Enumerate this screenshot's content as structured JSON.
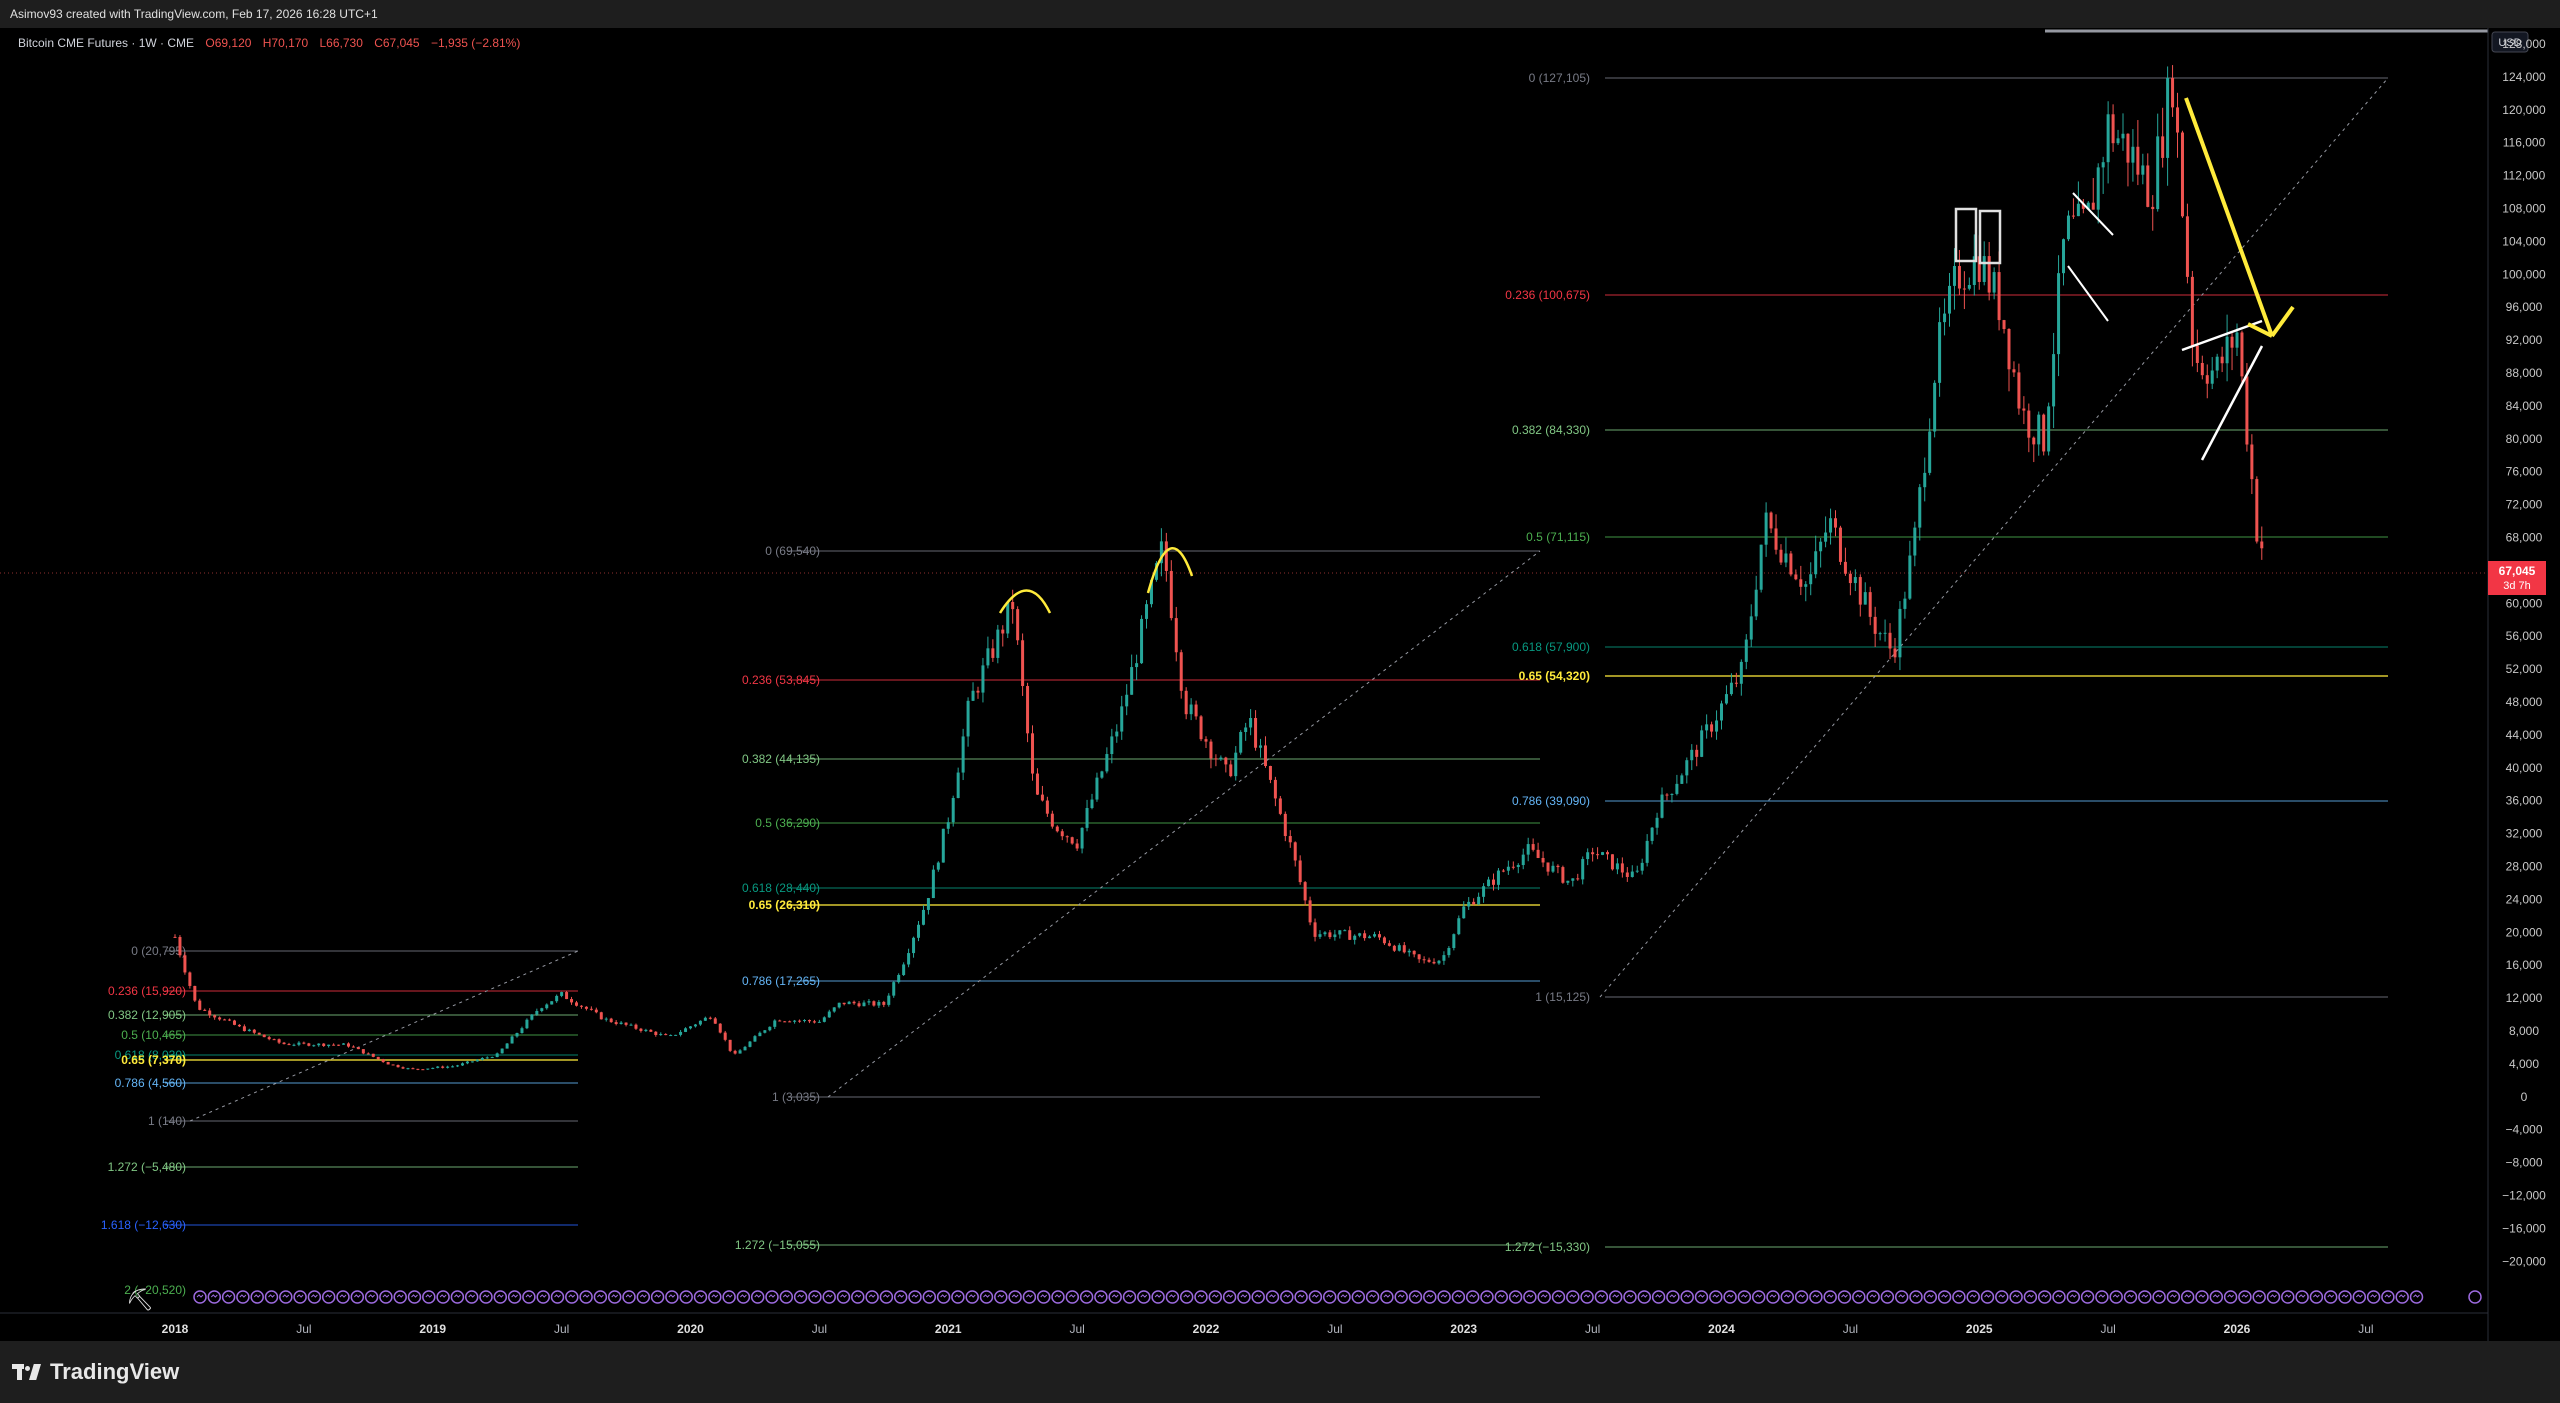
{
  "credit": "Asimov93 created with TradingView.com, Feb 17, 2026 16:28 UTC+1",
  "legend": {
    "symbol": "Bitcoin CME Futures · 1W · CME",
    "open": "O69,120",
    "high": "H70,170",
    "low": "L66,730",
    "close": "C67,045",
    "change": "−1,935 (−2.81%)"
  },
  "currency": "USD",
  "price_badge": {
    "price": "67,045",
    "countdown": "3d 7h"
  },
  "brand": "TradingView",
  "colors": {
    "up": "#26a69a",
    "down": "#ef5350",
    "background": "#000000",
    "fib_0": "#787b86",
    "fib_0236": "#f23645",
    "fib_0382": "#81c784",
    "fib_05": "#4caf50",
    "fib_0618": "#089981",
    "fib_065": "#ffeb3b",
    "fib_0786": "#64b5f6",
    "fib_1": "#787b86",
    "fib_1272": "#81c784",
    "fib_1618": "#2962ff",
    "annotation_yellow": "#ffeb3b"
  },
  "chart_data": {
    "type": "candlestick",
    "title": "",
    "y_axis_labels": [
      "128,000",
      "124,000",
      "120,000",
      "116,000",
      "112,000",
      "108,000",
      "104,000",
      "100,000",
      "96,000",
      "92,000",
      "88,000",
      "84,000",
      "80,000",
      "76,000",
      "72,000",
      "68,000",
      "64,000",
      "60,000",
      "56,000",
      "52,000",
      "48,000",
      "44,000",
      "40,000",
      "36,000",
      "32,000",
      "28,000",
      "24,000",
      "20,000",
      "16,000",
      "12,000",
      "8,000",
      "4,000",
      "0",
      "−4,000",
      "−8,000",
      "−12,000",
      "−16,000",
      "−20,000"
    ],
    "x_axis_labels": [
      {
        "label": "2018",
        "bold": true
      },
      {
        "label": "Jul",
        "bold": false
      },
      {
        "label": "2019",
        "bold": true
      },
      {
        "label": "Jul",
        "bold": false
      },
      {
        "label": "2020",
        "bold": true
      },
      {
        "label": "Jul",
        "bold": false
      },
      {
        "label": "2021",
        "bold": true
      },
      {
        "label": "Jul",
        "bold": false
      },
      {
        "label": "2022",
        "bold": true
      },
      {
        "label": "Jul",
        "bold": false
      },
      {
        "label": "2023",
        "bold": true
      },
      {
        "label": "Jul",
        "bold": false
      },
      {
        "label": "2024",
        "bold": true
      },
      {
        "label": "Jul",
        "bold": false
      },
      {
        "label": "2025",
        "bold": true
      },
      {
        "label": "Jul",
        "bold": false
      },
      {
        "label": "2026",
        "bold": true
      },
      {
        "label": "Jul",
        "bold": false
      }
    ],
    "price_path": [
      [
        "2018-01",
        19500
      ],
      [
        "2018-02",
        11000
      ],
      [
        "2018-04",
        8500
      ],
      [
        "2018-06",
        6500
      ],
      [
        "2018-09",
        6400
      ],
      [
        "2018-11",
        4000
      ],
      [
        "2018-12",
        3400
      ],
      [
        "2019-02",
        3800
      ],
      [
        "2019-04",
        5200
      ],
      [
        "2019-06",
        11000
      ],
      [
        "2019-07",
        12500
      ],
      [
        "2019-09",
        9500
      ],
      [
        "2019-12",
        7300
      ],
      [
        "2020-02",
        10000
      ],
      [
        "2020-03",
        5000
      ],
      [
        "2020-05",
        9500
      ],
      [
        "2020-07",
        9200
      ],
      [
        "2020-08",
        11500
      ],
      [
        "2020-10",
        11300
      ],
      [
        "2020-11",
        17000
      ],
      [
        "2020-12",
        24000
      ],
      [
        "2021-01",
        34000
      ],
      [
        "2021-02",
        48000
      ],
      [
        "2021-04",
        60000
      ],
      [
        "2021-05",
        37000
      ],
      [
        "2021-06",
        33000
      ],
      [
        "2021-07",
        31000
      ],
      [
        "2021-09",
        46000
      ],
      [
        "2021-11",
        67000
      ],
      [
        "2021-12",
        48000
      ],
      [
        "2022-02",
        39000
      ],
      [
        "2022-03",
        46000
      ],
      [
        "2022-05",
        30000
      ],
      [
        "2022-06",
        20000
      ],
      [
        "2022-09",
        19500
      ],
      [
        "2022-11",
        16500
      ],
      [
        "2022-12",
        16800
      ],
      [
        "2023-01",
        23000
      ],
      [
        "2023-03",
        28000
      ],
      [
        "2023-04",
        30000
      ],
      [
        "2023-06",
        26000
      ],
      [
        "2023-07",
        30000
      ],
      [
        "2023-09",
        26500
      ],
      [
        "2023-10",
        35000
      ],
      [
        "2023-12",
        43000
      ],
      [
        "2024-02",
        52000
      ],
      [
        "2024-03",
        70000
      ],
      [
        "2024-05",
        62000
      ],
      [
        "2024-06",
        70000
      ],
      [
        "2024-08",
        58000
      ],
      [
        "2024-09",
        54000
      ],
      [
        "2024-10",
        68000
      ],
      [
        "2024-11",
        90000
      ],
      [
        "2024-12",
        100000
      ],
      [
        "2025-01",
        102000
      ],
      [
        "2025-02",
        96000
      ],
      [
        "2025-03",
        83000
      ],
      [
        "2025-04",
        80000
      ],
      [
        "2025-05",
        105000
      ],
      [
        "2025-06",
        106000
      ],
      [
        "2025-07",
        118000
      ],
      [
        "2025-08",
        115000
      ],
      [
        "2025-09",
        110000
      ],
      [
        "2025-10",
        124000
      ],
      [
        "2025-11",
        90000
      ],
      [
        "2025-12",
        88000
      ],
      [
        "2026-01",
        93000
      ],
      [
        "2026-02",
        67045
      ]
    ],
    "fib_sets": [
      {
        "levels": [
          {
            "label": "0 (20,795)",
            "color": "fib_0"
          },
          {
            "label": "0.236 (15,920)",
            "color": "fib_0236"
          },
          {
            "label": "0.382 (12,905)",
            "color": "fib_0382"
          },
          {
            "label": "0.5 (10,465)",
            "color": "fib_05"
          },
          {
            "label": "0.618 (8,030)",
            "color": "fib_0618"
          },
          {
            "label": "0.65 (7,370)",
            "color": "fib_065"
          },
          {
            "label": "0.786 (4,560)",
            "color": "fib_0786"
          },
          {
            "label": "1 (140)",
            "color": "fib_1"
          },
          {
            "label": "1.272 (−5,480)",
            "color": "fib_1272"
          },
          {
            "label": "1.618 (−12,630)",
            "color": "fib_1618"
          },
          {
            "label": "2 (−20,520)",
            "color": "fib_05"
          }
        ]
      },
      {
        "levels": [
          {
            "label": "0 (69,540)",
            "color": "fib_0"
          },
          {
            "label": "0.236 (53,845)",
            "color": "fib_0236"
          },
          {
            "label": "0.382 (44,135)",
            "color": "fib_0382"
          },
          {
            "label": "0.5 (36,290)",
            "color": "fib_05"
          },
          {
            "label": "0.618 (28,440)",
            "color": "fib_0618"
          },
          {
            "label": "0.65 (26,310)",
            "color": "fib_065"
          },
          {
            "label": "0.786 (17,265)",
            "color": "fib_0786"
          },
          {
            "label": "1 (3,035)",
            "color": "fib_1"
          },
          {
            "label": "1.272 (−15,055)",
            "color": "fib_1272"
          }
        ]
      },
      {
        "levels": [
          {
            "label": "0 (127,105)",
            "color": "fib_0"
          },
          {
            "label": "0.236 (100,675)",
            "color": "fib_0236"
          },
          {
            "label": "0.382 (84,330)",
            "color": "fib_0382"
          },
          {
            "label": "0.5 (71,115)",
            "color": "fib_05"
          },
          {
            "label": "0.618 (57,900)",
            "color": "fib_0618"
          },
          {
            "label": "0.65 (54,320)",
            "color": "fib_065"
          },
          {
            "label": "0.786 (39,090)",
            "color": "fib_0786"
          },
          {
            "label": "1 (15,125)",
            "color": "fib_1"
          },
          {
            "label": "1.272 (−15,330)",
            "color": "fib_1272"
          }
        ]
      }
    ]
  }
}
